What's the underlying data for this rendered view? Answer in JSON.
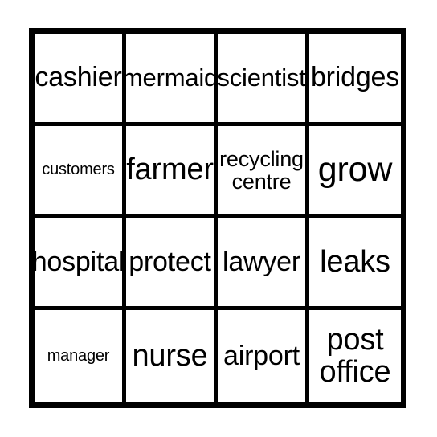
{
  "card": {
    "type": "bingo-card",
    "rows": 4,
    "columns": 4,
    "background_color": "#ffffff",
    "border_color": "#000000",
    "text_color": "#000000",
    "cells": [
      {
        "text": "cashier",
        "size": "sz-xl",
        "lines": 1
      },
      {
        "text": "mermaid",
        "size": "sz-lg",
        "lines": 1
      },
      {
        "text": "scientist",
        "size": "sz-lg",
        "lines": 1
      },
      {
        "text": "bridges",
        "size": "sz-xl",
        "lines": 1
      },
      {
        "text": "customers",
        "size": "sz-xs",
        "lines": 1
      },
      {
        "text": "farmer",
        "size": "sz-xxl",
        "lines": 1
      },
      {
        "text": "recycling\ncentre",
        "size": "sz-md",
        "lines": 2
      },
      {
        "text": "grow",
        "size": "sz-max",
        "lines": 1
      },
      {
        "text": "hospital",
        "size": "sz-xl",
        "lines": 1
      },
      {
        "text": "protect",
        "size": "sz-xl",
        "lines": 1
      },
      {
        "text": "lawyer",
        "size": "sz-xl",
        "lines": 1
      },
      {
        "text": "leaks",
        "size": "sz-xxl",
        "lines": 1
      },
      {
        "text": "manager",
        "size": "sz-xs",
        "lines": 1
      },
      {
        "text": "nurse",
        "size": "sz-xxl",
        "lines": 1
      },
      {
        "text": "airport",
        "size": "sz-xl",
        "lines": 1
      },
      {
        "text": "post\noffice",
        "size": "sz-xxl",
        "lines": 2
      }
    ]
  }
}
